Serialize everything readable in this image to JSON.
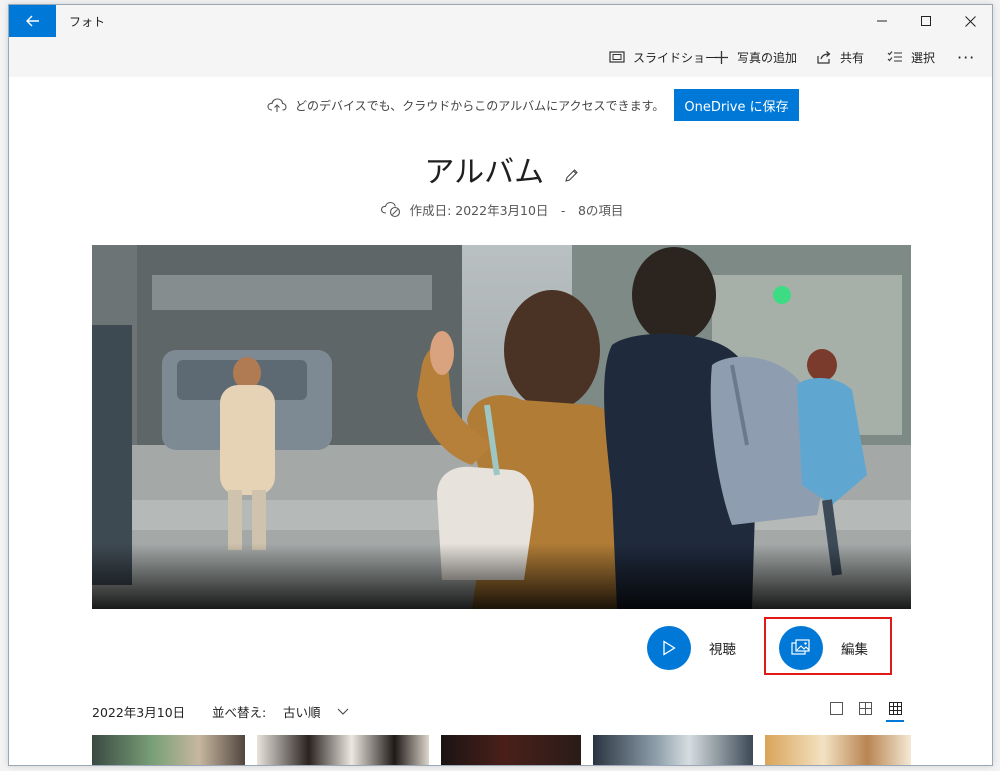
{
  "window": {
    "title": "フォト",
    "minimize": "—",
    "maximize": "☐",
    "close": "✕"
  },
  "toolbar": {
    "slideshow": "スライドショー",
    "add_photos": "写真の追加",
    "share": "共有",
    "select": "選択",
    "more": "···"
  },
  "banner": {
    "message": "どのデバイスでも、クラウドからこのアルバムにアクセスできます。",
    "button": "OneDrive に保存"
  },
  "album": {
    "title": "アルバム",
    "meta": "作成日: 2022年3月10日　-　8の項目"
  },
  "actions": {
    "view": "視聴",
    "edit": "編集"
  },
  "list": {
    "date": "2022年3月10日",
    "sort_label": "並べ替え:",
    "sort_value": "古い順"
  },
  "colors": {
    "accent": "#0078d7",
    "highlight": "#e11919"
  },
  "icons": [
    "back-arrow-icon",
    "slideshow-icon",
    "plus-icon",
    "share-icon",
    "select-icon",
    "cloud-upload-icon",
    "pencil-icon",
    "cloud-sync-icon",
    "play-icon",
    "edit-photo-icon",
    "chevron-down-icon",
    "view-large-icon",
    "view-medium-icon",
    "view-small-icon"
  ]
}
